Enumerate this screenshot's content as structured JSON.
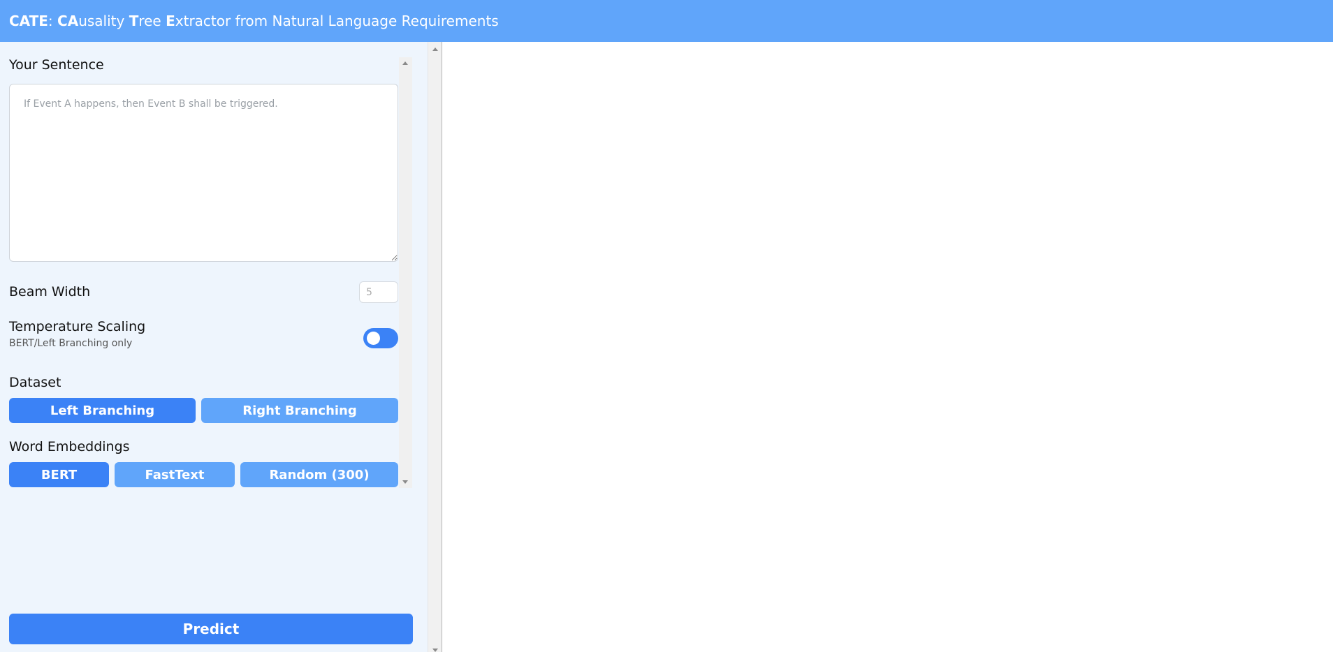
{
  "header": {
    "title_parts": [
      {
        "text": "CATE",
        "bold": true
      },
      {
        "text": ": ",
        "bold": false
      },
      {
        "text": "CA",
        "bold": true
      },
      {
        "text": "usality ",
        "bold": false
      },
      {
        "text": "T",
        "bold": true
      },
      {
        "text": "ree ",
        "bold": false
      },
      {
        "text": "E",
        "bold": true
      },
      {
        "text": "xtractor from Natural Language Requirements",
        "bold": false
      }
    ],
    "background_color": "#60a5fa"
  },
  "settings": {
    "sentence_label": "Your Sentence",
    "sentence_placeholder": "If Event A happens, then Event B shall be triggered.",
    "sentence_value": "",
    "beam_width_label": "Beam Width",
    "beam_width_placeholder": "5",
    "temperature_label": "Temperature Scaling",
    "temperature_sublabel": "BERT/Left Branching only",
    "temperature_enabled": false,
    "dataset_label": "Dataset",
    "dataset_options": [
      {
        "label": "Left Branching",
        "selected": true
      },
      {
        "label": "Right Branching",
        "selected": false
      }
    ],
    "embeddings_label": "Word Embeddings",
    "embedding_options": [
      {
        "label": "BERT",
        "selected": true
      },
      {
        "label": "FastText",
        "selected": false
      },
      {
        "label": "Random (300)",
        "selected": false
      }
    ]
  },
  "actions": {
    "predict_label": "Predict"
  },
  "colors": {
    "accent": "#3b82f6",
    "accent_light": "#60a5fa",
    "sidebar_bg": "#eef5fd"
  }
}
